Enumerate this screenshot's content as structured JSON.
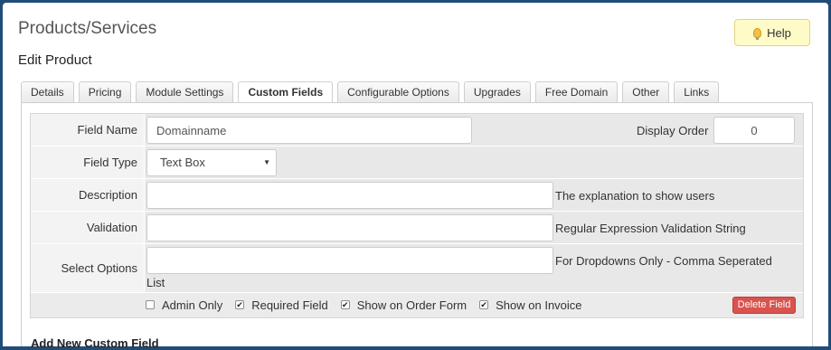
{
  "header": {
    "title": "Products/Services",
    "help_label": "Help",
    "subtitle": "Edit Product"
  },
  "tabs": [
    {
      "label": "Details",
      "active": false
    },
    {
      "label": "Pricing",
      "active": false
    },
    {
      "label": "Module Settings",
      "active": false
    },
    {
      "label": "Custom Fields",
      "active": true
    },
    {
      "label": "Configurable Options",
      "active": false
    },
    {
      "label": "Upgrades",
      "active": false
    },
    {
      "label": "Free Domain",
      "active": false
    },
    {
      "label": "Other",
      "active": false
    },
    {
      "label": "Links",
      "active": false
    }
  ],
  "form": {
    "field_name_label": "Field Name",
    "field_name_value": "Domainname",
    "display_order_label": "Display Order",
    "display_order_value": "0",
    "field_type_label": "Field Type",
    "field_type_value": "Text Box",
    "description_label": "Description",
    "description_value": "",
    "description_hint": "The explanation to show users",
    "validation_label": "Validation",
    "validation_value": "",
    "validation_hint": "Regular Expression Validation String",
    "select_options_label": "Select Options",
    "select_options_value": "",
    "select_options_hint": "For Dropdowns Only - Comma Seperated",
    "select_options_hint_wrap": "List"
  },
  "checkboxes": [
    {
      "label": "Admin Only",
      "checked": false
    },
    {
      "label": "Required Field",
      "checked": true
    },
    {
      "label": "Show on Order Form",
      "checked": true
    },
    {
      "label": "Show on Invoice",
      "checked": true
    }
  ],
  "delete_label": "Delete Field",
  "add_new_heading": "Add New Custom Field",
  "colors": {
    "help_bg": "#fffbc7",
    "delete_bg": "#d9534f",
    "outer_bg": "#1f4d7a"
  }
}
